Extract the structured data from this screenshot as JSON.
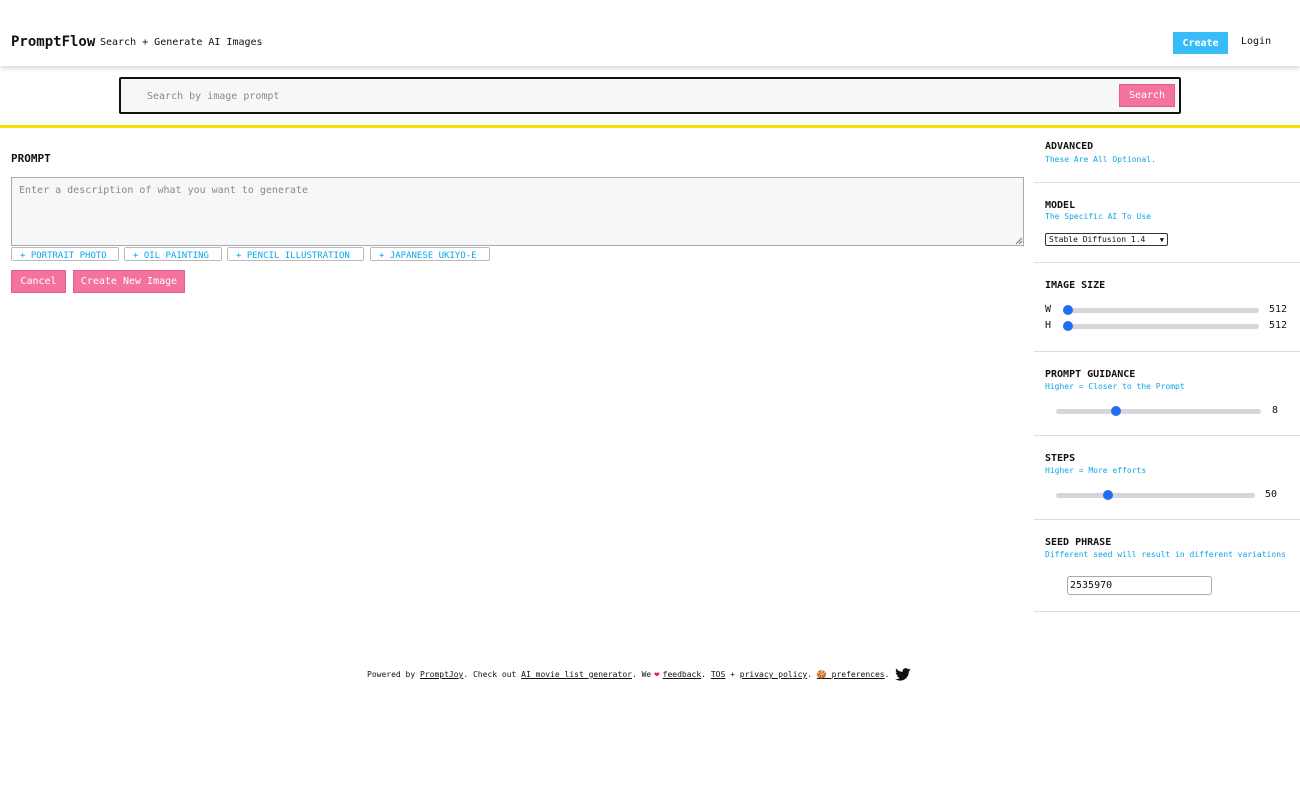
{
  "header": {
    "brand": "PromptFlow",
    "tagline": "Search + Generate AI Images",
    "create_label": "Create",
    "login_label": "Login"
  },
  "search": {
    "placeholder": "Search by image prompt",
    "button_label": "Search"
  },
  "prompt": {
    "title": "PROMPT",
    "placeholder": "Enter a description of what you want to generate",
    "chips": [
      "+ PORTRAIT PHOTO",
      "+ OIL PAINTING",
      "+ PENCIL ILLUSTRATION",
      "+ JAPANESE UKIYO-E"
    ],
    "cancel_label": "Cancel",
    "generate_label": "Create New Image"
  },
  "sidebar": {
    "advanced": {
      "title": "ADVANCED",
      "subtitle": "These Are All Optional."
    },
    "model": {
      "title": "MODEL",
      "subtitle": "The Specific AI To Use",
      "selected": "Stable Diffusion 1.4"
    },
    "image_size": {
      "title": "IMAGE SIZE",
      "w_label": "W",
      "h_label": "H",
      "w_value": "512",
      "h_value": "512",
      "w_fraction": 0.0,
      "h_fraction": 0.0
    },
    "guidance": {
      "title": "PROMPT GUIDANCE",
      "subtitle": "Higher = Closer to the Prompt",
      "value": "8",
      "fraction": 0.28
    },
    "steps": {
      "title": "STEPS",
      "subtitle": "Higher = More efforts",
      "value": "50",
      "fraction": 0.25
    },
    "seed": {
      "title": "SEED PHRASE",
      "subtitle": "Different seed will result in different variations",
      "value": "2535970"
    }
  },
  "footer": {
    "powered_by": "Powered by",
    "promptjoy": "PromptJoy",
    "check_out": ". Check out",
    "movie_link": "AI movie list generator",
    "we": ". We",
    "feedback": "feedback",
    "dot": ".",
    "tos": "TOS",
    "plus": "+",
    "privacy": "privacy policy",
    "dot2": ".",
    "preferences": "🍪 preferences",
    "dot3": "."
  },
  "colors": {
    "accent_blue": "#38bdf8",
    "accent_pink": "#f472a0",
    "divider_yellow": "#f2e200",
    "slider_thumb": "#1f6ff2"
  },
  "icons": [
    "heart-icon",
    "twitter-icon",
    "cookie-icon",
    "chevron-down-icon"
  ]
}
